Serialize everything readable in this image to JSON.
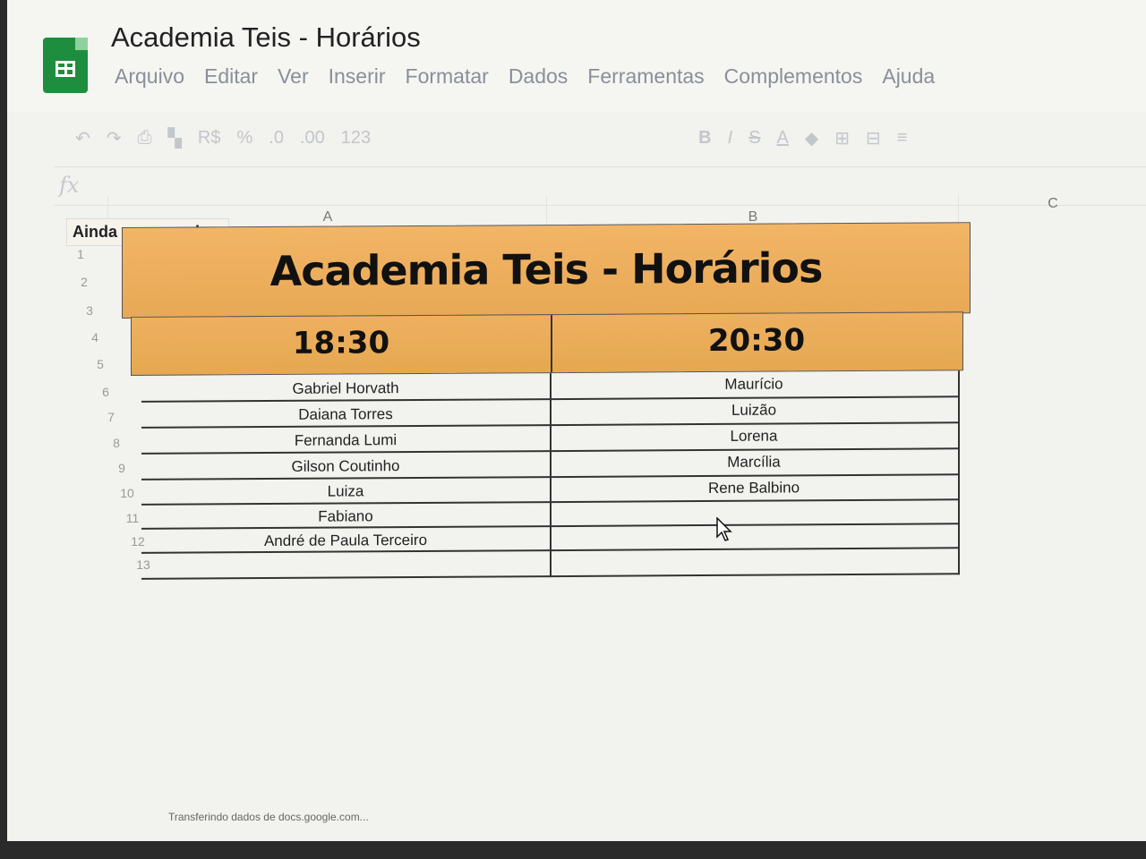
{
  "app": {
    "doc_title": "Academia Teis - Horários",
    "menu": [
      "Arquivo",
      "Editar",
      "Ver",
      "Inserir",
      "Formatar",
      "Dados",
      "Ferramentas",
      "Complementos",
      "Ajuda"
    ],
    "toolbar": {
      "currency": "R$",
      "percent": "%",
      "dec_less": ".0",
      "dec_more": ".00",
      "format_more": "123",
      "bold": "B",
      "italic": "I",
      "strike": "S",
      "text_color": "A"
    },
    "fx_label": "fx",
    "loading_text": "Ainda carregando...",
    "columns": [
      "A",
      "B",
      "C"
    ],
    "status_text": "Transferindo dados de docs.google.com..."
  },
  "sheet": {
    "title": "Academia Teis - Horários",
    "header_color": "#e8a955",
    "times": [
      "18:30",
      "20:30"
    ],
    "rows": [
      [
        "Gabriel Horvath",
        "Maurício"
      ],
      [
        "Daiana Torres",
        "Luizão"
      ],
      [
        "Fernanda Lumi",
        "Lorena"
      ],
      [
        "Gilson Coutinho",
        "Marcília"
      ],
      [
        "Luiza",
        "Rene Balbino"
      ],
      [
        "Fabiano",
        ""
      ],
      [
        "André de Paula Terceiro",
        ""
      ],
      [
        "",
        ""
      ]
    ],
    "row_numbers": [
      "1",
      "2",
      "3",
      "4",
      "5",
      "6",
      "7",
      "8",
      "9",
      "10",
      "11",
      "12",
      "13"
    ]
  }
}
